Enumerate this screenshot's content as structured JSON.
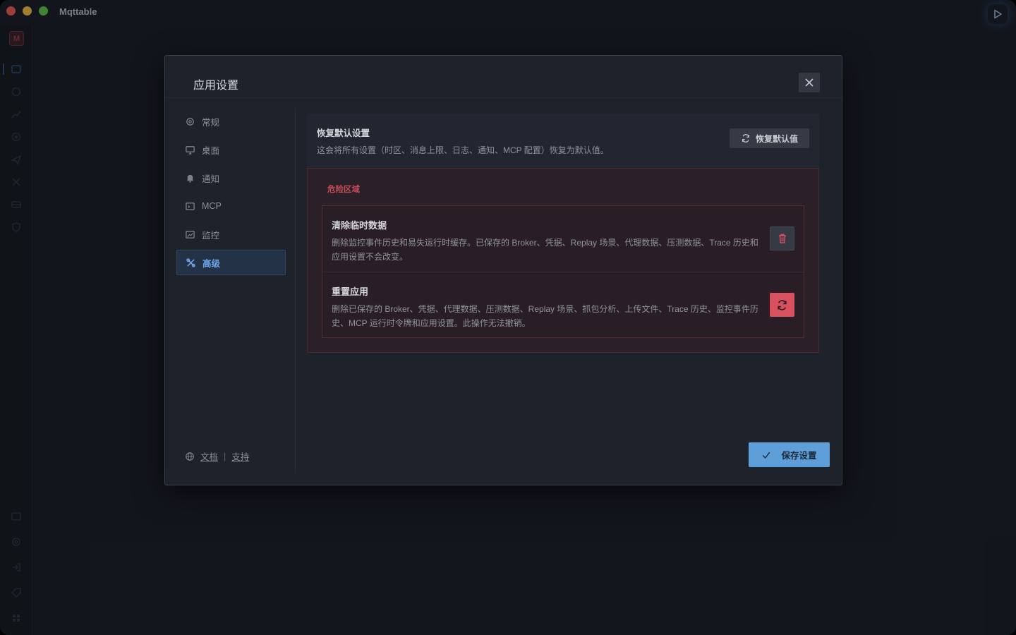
{
  "app": {
    "title": "Mqttable",
    "logo_letter": "M"
  },
  "rail": {
    "icons": [
      "logo-icon",
      "connections-icon",
      "subscribe-icon",
      "chart-icon",
      "monitor-icon",
      "publish-icon",
      "tools-icon",
      "database-icon",
      "shield-icon",
      "terminal-icon",
      "settings-icon",
      "logout-icon",
      "tag-icon",
      "grid-icon"
    ]
  },
  "dialog": {
    "title": "应用设置",
    "nav": [
      {
        "label": "常规",
        "icon": "gear-icon"
      },
      {
        "label": "桌面",
        "icon": "monitor-icon"
      },
      {
        "label": "通知",
        "icon": "bell-icon"
      },
      {
        "label": "MCP",
        "icon": "terminal-icon"
      },
      {
        "label": "监控",
        "icon": "chart-icon"
      },
      {
        "label": "高级",
        "icon": "tools-icon",
        "active": true
      }
    ],
    "footer": {
      "docs": "文档",
      "separator": "|",
      "support": "支持"
    },
    "restore": {
      "title": "恢复默认设置",
      "description": "这会将所有设置（时区、消息上限、日志、通知、MCP 配置）恢复为默认值。",
      "button": "恢复默认值"
    },
    "danger": {
      "label": "危险区域",
      "rows": [
        {
          "title": "清除临时数据",
          "description": "删除监控事件历史和易失运行时缓存。已保存的 Broker、凭据、Replay 场景、代理数据、压测数据、Trace 历史和应用设置不会改变。",
          "action_icon": "trash-icon"
        },
        {
          "title": "重置应用",
          "description": "删除已保存的 Broker、凭据、代理数据、压测数据、Replay 场景、抓包分析、上传文件、Trace 历史、监控事件历史、MCP 运行时令牌和应用设置。此操作无法撤销。",
          "action_icon": "refresh-icon"
        }
      ]
    },
    "save_button": "保存设置"
  },
  "colors": {
    "accent": "#5f9fd9",
    "danger": "#d9505e",
    "danger_text": "#c24c5a"
  }
}
